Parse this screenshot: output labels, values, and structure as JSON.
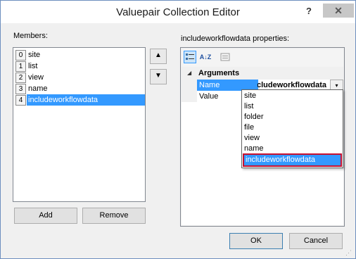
{
  "window": {
    "title": "Valuepair Collection Editor",
    "help": "?",
    "close": "✕"
  },
  "members": {
    "label": "Members:",
    "items": [
      {
        "index": "0",
        "label": "site"
      },
      {
        "index": "1",
        "label": "list"
      },
      {
        "index": "2",
        "label": "view"
      },
      {
        "index": "3",
        "label": "name"
      },
      {
        "index": "4",
        "label": "includeworkflowdata"
      }
    ],
    "selected_index": 4,
    "up_glyph": "▲",
    "down_glyph": "▼",
    "add_label": "Add",
    "remove_label": "Remove"
  },
  "properties": {
    "label": "includeworkflowdata properties:",
    "toolbar": {
      "categorized_icon": "categorized-icon",
      "alphabetical_icon": "alphabetical-icon",
      "alphabetical_glyph": "A↓Z",
      "property_pages_icon": "property-pages-icon"
    },
    "category": {
      "collapse_glyph": "◢",
      "label": "Arguments"
    },
    "rows": [
      {
        "name": "Name",
        "value": "includeworkflowdata",
        "selected": true
      },
      {
        "name": "Value",
        "value": "",
        "selected": false
      }
    ],
    "dropdown_glyph": "▾",
    "dropdown_options": [
      "site",
      "list",
      "folder",
      "file",
      "view",
      "name",
      "includeworkflowdata"
    ],
    "dropdown_selected": 6
  },
  "buttons": {
    "ok_label": "OK",
    "cancel_label": "Cancel"
  },
  "colors": {
    "selection": "#3399ff",
    "highlight_box": "#c8102e"
  }
}
